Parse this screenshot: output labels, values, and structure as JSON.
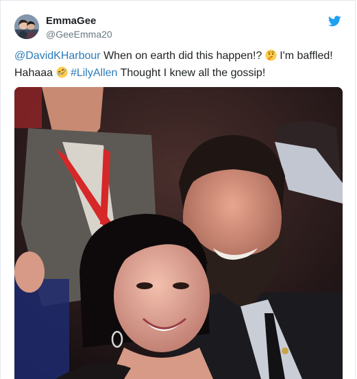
{
  "user": {
    "display_name": "EmmaGee",
    "handle": "@GeeEmma20"
  },
  "tweet": {
    "mention": "@DavidKHarbour",
    "text_1": " When on earth did this happen!? ",
    "text_2": " I'm baffled!",
    "text_3": "Hahaaa ",
    "hashtag": "#LilyAllen",
    "text_4": " Thought I knew all the gossip!",
    "emoji_1": "thinking-face-emoji",
    "emoji_2": "rolling-laughing-emoji"
  },
  "icons": {
    "brand": "twitter-bird-icon"
  },
  "colors": {
    "link": "#2b7bb9",
    "brand": "#1da1f2",
    "handle": "#697882",
    "text": "#1c2022"
  }
}
